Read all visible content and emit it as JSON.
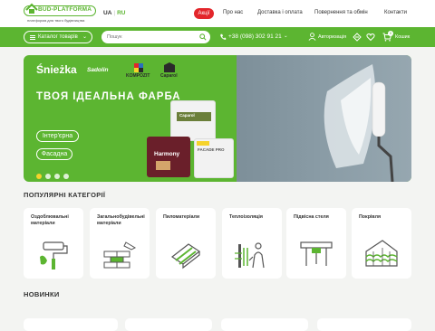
{
  "header": {
    "logo_text": "BUD-PLATFORMA",
    "logo_tagline": "платформа для твого будівництва",
    "lang_ua": "UA",
    "lang_sep": "|",
    "lang_ru": "RU",
    "promo_label": "Акції",
    "nav": [
      "Про нас",
      "Доставка і оплата",
      "Повернення та обмін",
      "Контакти"
    ]
  },
  "toolbar": {
    "catalog_label": "Каталог товарів",
    "search_placeholder": "Пошук",
    "phone": "+38 (098) 302 91 21",
    "account_label": "Авторизація",
    "cart_count": "0",
    "cart_label": "Кошик"
  },
  "hero": {
    "brands": [
      "Śnieżka",
      "Sadolin",
      "KOMPOZIT",
      "Caparol"
    ],
    "title": "ТВОЯ ІДЕАЛЬНА ФАРБА",
    "pills": [
      "Інтер'єрна",
      "Фасадна"
    ],
    "slides_count": 4,
    "active_slide": 1,
    "cans": [
      "Caparol",
      "Harmony",
      "FACADE PRO"
    ]
  },
  "categories": {
    "title": "ПОПУЛЯРНІ КАТЕГОРІЇ",
    "items": [
      {
        "name": "Оздоблювальні матеріали",
        "icon": "paint-roller-icon"
      },
      {
        "name": "Загальнобудівельні матеріали",
        "icon": "brick-wall-icon"
      },
      {
        "name": "Пиломатеріали",
        "icon": "lumber-icon"
      },
      {
        "name": "Теплоізоляція",
        "icon": "insulation-icon"
      },
      {
        "name": "Підвісна стеля",
        "icon": "suspended-ceiling-icon"
      },
      {
        "name": "Покрівля",
        "icon": "roof-tiles-icon"
      }
    ]
  },
  "new_section": {
    "title": "НОВИНКИ"
  },
  "colors": {
    "brand_green": "#5cb531",
    "promo_red": "#e3262b",
    "slide_dot_active": "#f6d32b"
  }
}
